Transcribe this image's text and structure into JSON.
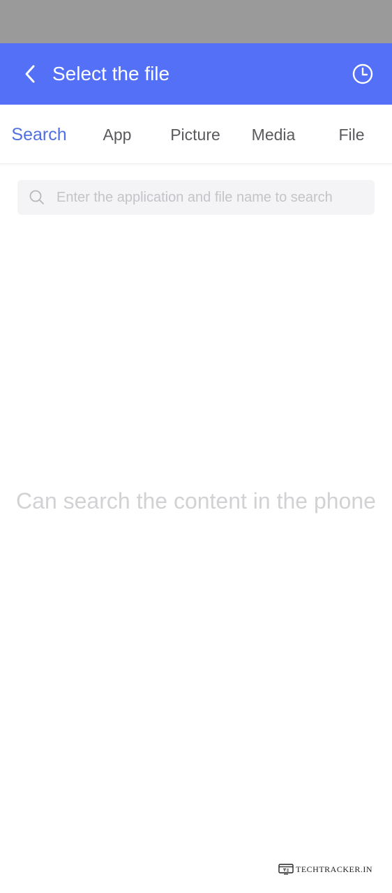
{
  "header": {
    "title": "Select the file",
    "background_color": "#5370f7",
    "back_icon": "chevron-left-icon",
    "history_icon": "clock-icon"
  },
  "tabs": [
    {
      "label": "Search",
      "active": true
    },
    {
      "label": "App",
      "active": false
    },
    {
      "label": "Picture",
      "active": false
    },
    {
      "label": "Media",
      "active": false
    },
    {
      "label": "File",
      "active": false
    }
  ],
  "tab_colors": {
    "active": "#4f6fe2",
    "inactive": "#5a5a5e"
  },
  "search": {
    "placeholder": "Enter the application and file name to search",
    "value": "",
    "icon": "search-icon"
  },
  "empty_state": {
    "message": "Can search the content in the phone"
  },
  "watermark": {
    "text": "TECHTRACKER.IN"
  }
}
